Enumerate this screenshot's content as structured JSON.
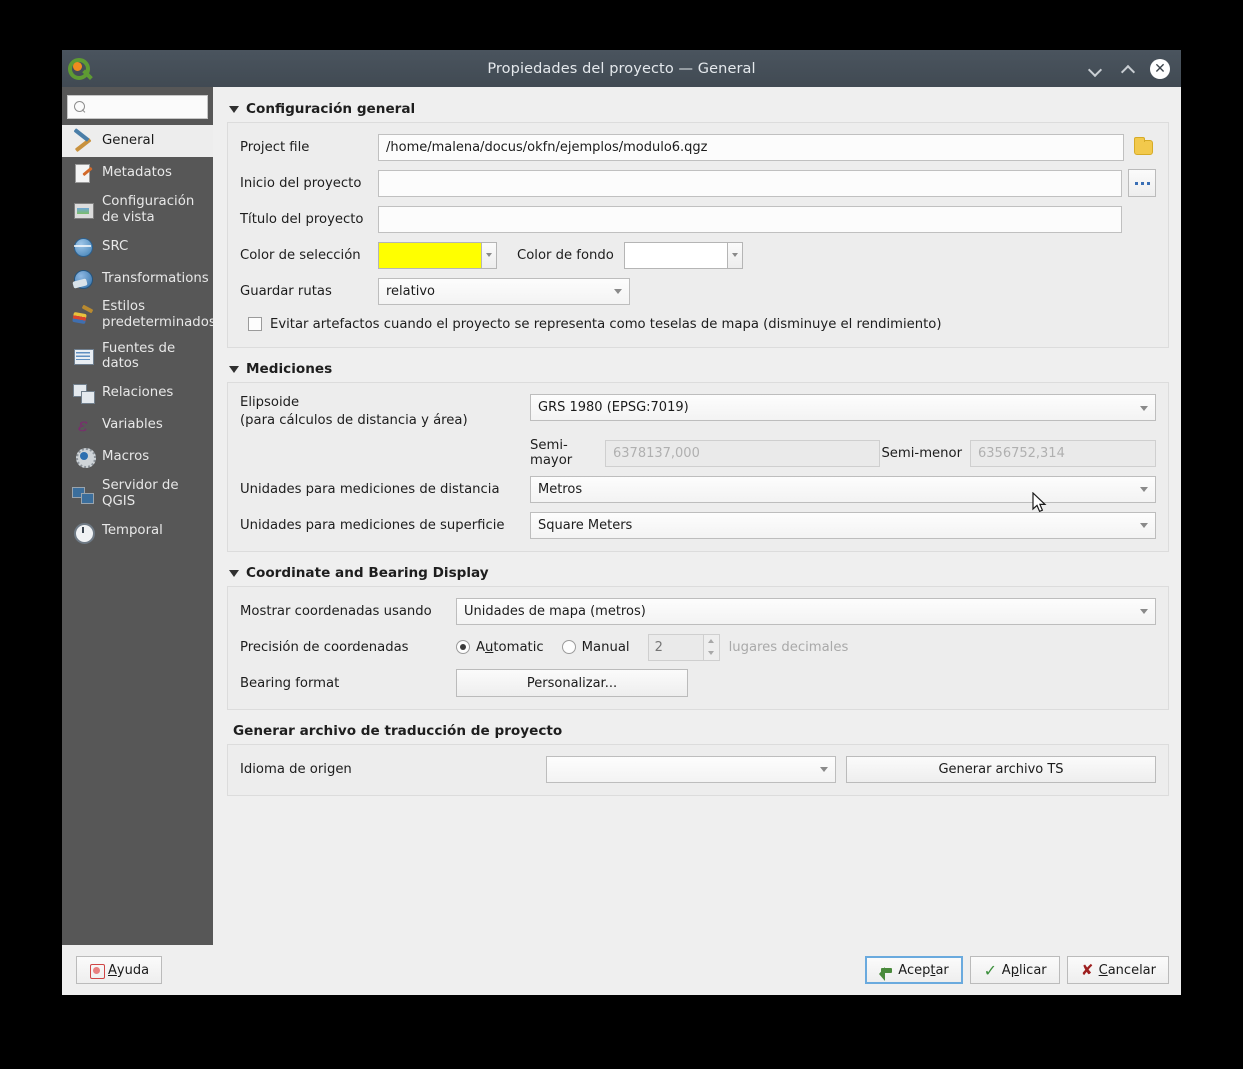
{
  "window": {
    "title": "Propiedades del proyecto — General",
    "logo_icon": "qgis-logo-icon",
    "minimize_icon": "chevron-down-icon",
    "maximize_icon": "chevron-up-icon",
    "close_icon": "close-icon",
    "close_glyph": "✕"
  },
  "sidebar": {
    "search": {
      "placeholder": "",
      "value": "",
      "icon": "search-icon"
    },
    "items": [
      {
        "label": "General",
        "icon": "hammer-wrench-icon",
        "active": true
      },
      {
        "label": "Metadatos",
        "icon": "document-edit-icon",
        "active": false
      },
      {
        "label": "Configuración de vista",
        "icon": "map-view-icon",
        "active": false
      },
      {
        "label": "SRC",
        "icon": "globe-icon",
        "active": false
      },
      {
        "label": "Transformations",
        "icon": "globe-transform-icon",
        "active": false
      },
      {
        "label": "Estilos predeterminados",
        "icon": "paintbrush-icon",
        "active": false
      },
      {
        "label": "Fuentes de datos",
        "icon": "data-table-icon",
        "active": false
      },
      {
        "label": "Relaciones",
        "icon": "relations-icon",
        "active": false
      },
      {
        "label": "Variables",
        "icon": "variables-epsilon-icon",
        "active": false
      },
      {
        "label": "Macros",
        "icon": "gear-play-icon",
        "active": false
      },
      {
        "label": "Servidor de QGIS",
        "icon": "server-icon",
        "active": false
      },
      {
        "label": "Temporal",
        "icon": "clock-icon",
        "active": false
      }
    ]
  },
  "general_section": {
    "title": "Configuración general",
    "project_file": {
      "label": "Project file",
      "value": "/home/malena/docus/okfn/ejemplos/modulo6.qgz",
      "browse_icon": "folder-icon"
    },
    "project_home": {
      "label": "Inicio del proyecto",
      "value": "",
      "browse_label": "..."
    },
    "project_title": {
      "label": "Título del proyecto",
      "value": ""
    },
    "selection_color": {
      "label": "Color de selección",
      "color": "#FFFF00"
    },
    "background_color": {
      "label": "Color de fondo",
      "color": "#FFFFFF"
    },
    "save_paths": {
      "label": "Guardar rutas",
      "value": "relativo"
    },
    "avoid_artifacts": {
      "label": "Evitar artefactos cuando el proyecto se representa como teselas de mapa (disminuye el rendimiento)",
      "checked": false
    }
  },
  "measurements_section": {
    "title": "Mediciones",
    "ellipsoid": {
      "label_line1": "Elipsoide",
      "label_line2": "(para cálculos de distancia y área)",
      "value": "GRS 1980 (EPSG:7019)"
    },
    "semi_major": {
      "label": "Semi-mayor",
      "value": "6378137,000",
      "disabled": true
    },
    "semi_minor": {
      "label": "Semi-menor",
      "value": "6356752,314",
      "disabled": true
    },
    "distance_units": {
      "label": "Unidades para mediciones de distancia",
      "value": "Metros"
    },
    "area_units": {
      "label": "Unidades para mediciones de superficie",
      "value": "Square Meters"
    }
  },
  "coordinate_section": {
    "title": "Coordinate and Bearing Display",
    "show_coordinates": {
      "label": "Mostrar coordenadas usando",
      "value": "Unidades de mapa (metros)"
    },
    "precision": {
      "label": "Precisión de coordenadas",
      "automatic_label": "Automatic",
      "automatic_mnemonic": "u",
      "manual_label": "Manual",
      "selected": "Automatic",
      "decimals_value": "2",
      "decimals_suffix": "lugares decimales"
    },
    "bearing_format": {
      "label": "Bearing format",
      "button_label": "Personalizar..."
    }
  },
  "translation_section": {
    "title": "Generar archivo de traducción de proyecto",
    "source_language": {
      "label": "Idioma de origen",
      "value": ""
    },
    "generate_button": {
      "label": "Generar archivo TS"
    }
  },
  "footer": {
    "help": {
      "label": "Ayuda",
      "mnemonic": "A",
      "icon": "help-icon"
    },
    "ok": {
      "label": "Aceptar",
      "mnemonic": "t",
      "icon": "ok-arrow-icon"
    },
    "apply": {
      "label": "Aplicar",
      "mnemonic": "p",
      "icon": "check-icon",
      "glyph": "✓"
    },
    "cancel": {
      "label": "Cancelar",
      "mnemonic": "C",
      "icon": "cancel-x-icon",
      "glyph": "✘"
    }
  }
}
